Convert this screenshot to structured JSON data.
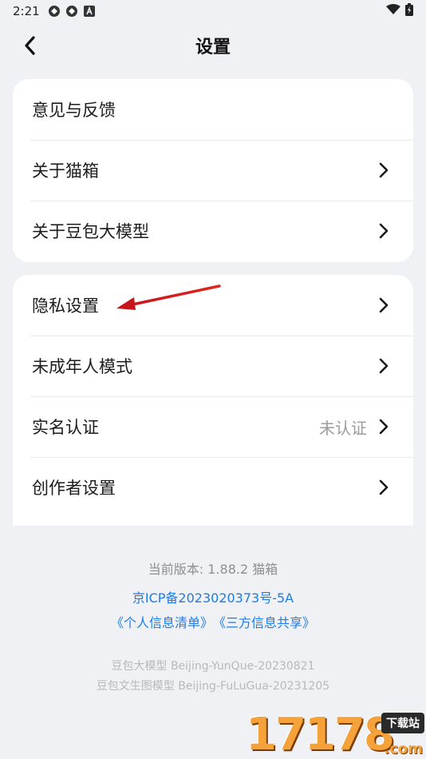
{
  "status_bar": {
    "time": "2:21"
  },
  "header": {
    "title": "设置"
  },
  "group1": [
    {
      "label": "意见与反馈",
      "chevron": false
    },
    {
      "label": "关于猫箱",
      "chevron": true
    },
    {
      "label": "关于豆包大模型",
      "chevron": true
    }
  ],
  "group2": [
    {
      "label": "隐私设置",
      "chevron": true
    },
    {
      "label": "未成年人模式",
      "chevron": true
    },
    {
      "label": "实名认证",
      "value": "未认证",
      "chevron": true
    },
    {
      "label": "创作者设置",
      "chevron": true
    }
  ],
  "footer": {
    "version": "当前版本: 1.88.2 猫箱",
    "icp": "京ICP备2023020373号-5A",
    "link_personal": "《个人信息清单》",
    "link_third": "《三方信息共享》",
    "model_line1": "豆包大模型 Beijing-YunQue-20230821",
    "model_line2": "豆包文生图模型 Beijing-FuLuGua-20231205"
  },
  "watermark": {
    "digits": "17178",
    "badge": "下载站",
    "domain": ".com"
  },
  "colors": {
    "background": "#f0f1f5",
    "link": "#1e7ce6",
    "annotation_arrow": "#e0261f"
  }
}
